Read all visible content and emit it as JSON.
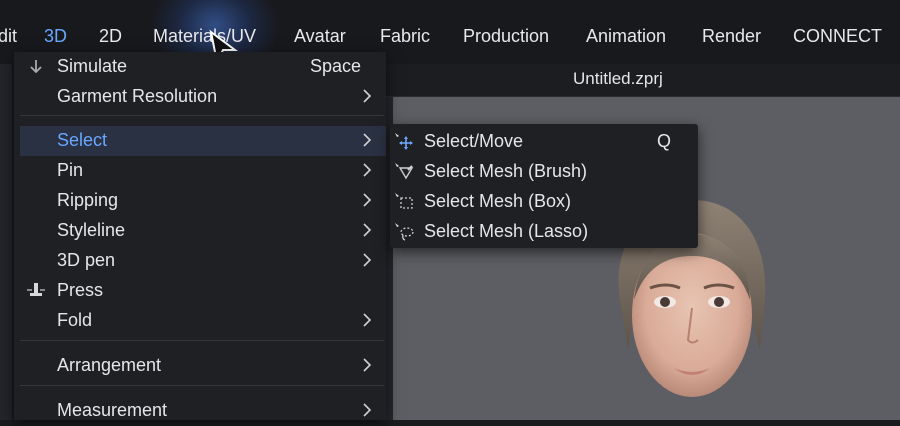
{
  "menubar": {
    "items": [
      "dit",
      "3D",
      "2D",
      "Materials/UV",
      "Avatar",
      "Fabric",
      "Production",
      "Animation",
      "Render",
      "CONNECT"
    ],
    "active_index": 1
  },
  "document": {
    "title": "Untitled.zprj"
  },
  "menu": {
    "items": [
      {
        "label": "Simulate",
        "shortcut": "Space",
        "icon": "simulate-arrow-icon"
      },
      {
        "label": "Garment Resolution",
        "submenu": true
      },
      {
        "label": "Select",
        "submenu": true,
        "highlighted": true
      },
      {
        "label": "Pin",
        "submenu": true
      },
      {
        "label": "Ripping",
        "submenu": true
      },
      {
        "label": "Styleline",
        "submenu": true
      },
      {
        "label": "3D pen",
        "submenu": true
      },
      {
        "label": "Press",
        "icon": "press-icon"
      },
      {
        "label": "Fold",
        "submenu": true
      },
      {
        "label": "Arrangement",
        "submenu": true
      },
      {
        "label": "Measurement",
        "submenu": true
      }
    ]
  },
  "submenu": {
    "items": [
      {
        "label": "Select/Move",
        "shortcut": "Q",
        "icon": "select-move-icon"
      },
      {
        "label": "Select Mesh (Brush)",
        "icon": "select-mesh-brush-icon"
      },
      {
        "label": "Select Mesh (Box)",
        "icon": "select-mesh-box-icon"
      },
      {
        "label": "Select Mesh (Lasso)",
        "icon": "select-mesh-lasso-icon"
      }
    ]
  },
  "colors": {
    "accent": "#6aa7ff",
    "menu_bg": "#1f2024",
    "highlight_bg": "#2a3142"
  }
}
